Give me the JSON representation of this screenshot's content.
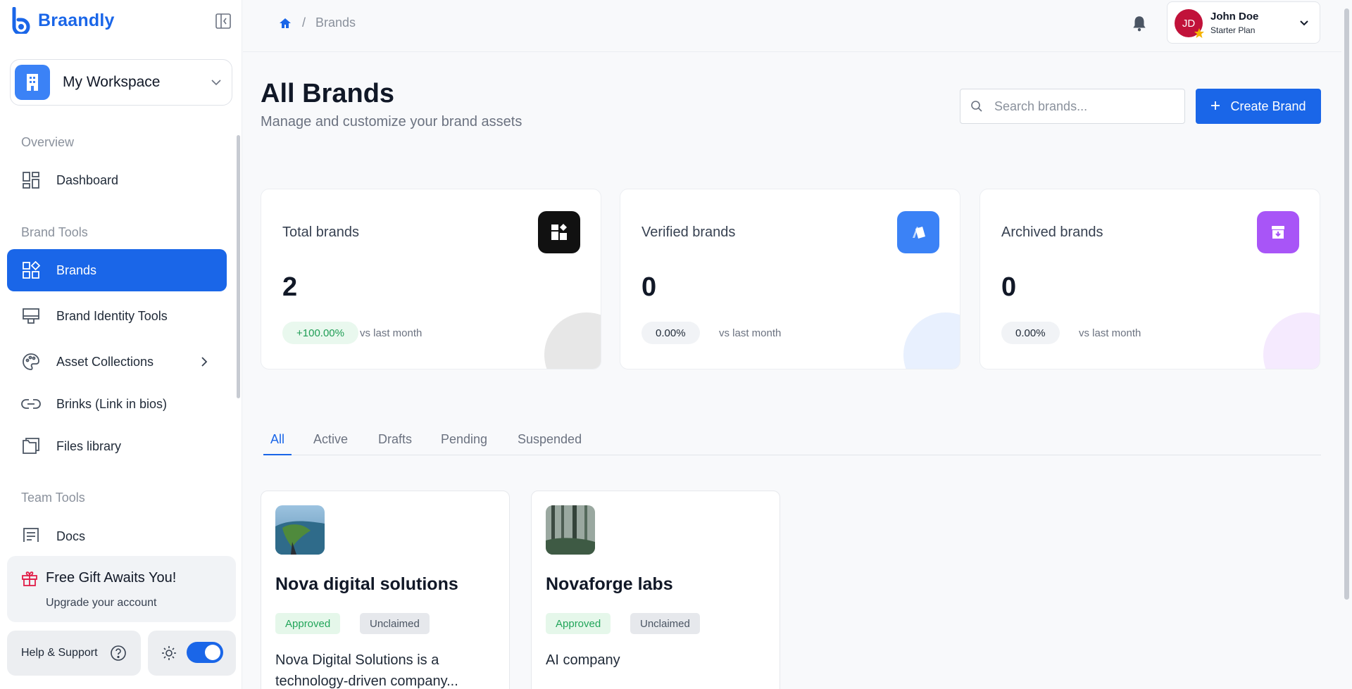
{
  "brand": {
    "name": "Braandly",
    "color": "#1a66e8"
  },
  "workspace": {
    "name": "My Workspace"
  },
  "sidebar": {
    "sections": [
      {
        "label": "Overview"
      },
      {
        "label": "Brand Tools"
      },
      {
        "label": "Team Tools"
      }
    ],
    "items": [
      {
        "label": "Dashboard",
        "icon": "dashboard-icon"
      },
      {
        "label": "Brands",
        "icon": "brands-icon",
        "active": true
      },
      {
        "label": "Brand Identity Tools",
        "icon": "monitor-icon"
      },
      {
        "label": "Asset Collections",
        "icon": "palette-icon"
      },
      {
        "label": "Brinks (Link in bios)",
        "icon": "link-icon"
      },
      {
        "label": "Files library",
        "icon": "folder-icon"
      },
      {
        "label": "Docs",
        "icon": "document-icon"
      }
    ],
    "gift": {
      "title": "Free Gift Awaits You!",
      "subtitle": "Upgrade your account"
    },
    "help_label": "Help & Support"
  },
  "topbar": {
    "breadcrumb": {
      "current": "Brands"
    },
    "user": {
      "initials": "JD",
      "name": "John Doe",
      "plan": "Starter Plan"
    }
  },
  "main": {
    "title": "All Brands",
    "subtitle": "Manage and customize your brand assets",
    "search_placeholder": "Search brands...",
    "create_label": "Create Brand",
    "stats": [
      {
        "label": "Total brands",
        "value": "2",
        "change": "+100.00%",
        "vs": "vs last month",
        "icon_color": "#111111"
      },
      {
        "label": "Verified brands",
        "value": "0",
        "change": "0.00%",
        "vs": "vs last month",
        "icon_color": "#3b82f6"
      },
      {
        "label": "Archived brands",
        "value": "0",
        "change": "0.00%",
        "vs": "vs last month",
        "icon_color": "#a855f7"
      }
    ],
    "tabs": [
      "All",
      "Active",
      "Drafts",
      "Pending",
      "Suspended"
    ],
    "brands": [
      {
        "name": "Nova digital solutions",
        "status": "Approved",
        "claim": "Unclaimed",
        "description": "Nova Digital Solutions is a technology-driven company..."
      },
      {
        "name": "Novaforge labs",
        "status": "Approved",
        "claim": "Unclaimed",
        "description": "AI company"
      }
    ]
  }
}
